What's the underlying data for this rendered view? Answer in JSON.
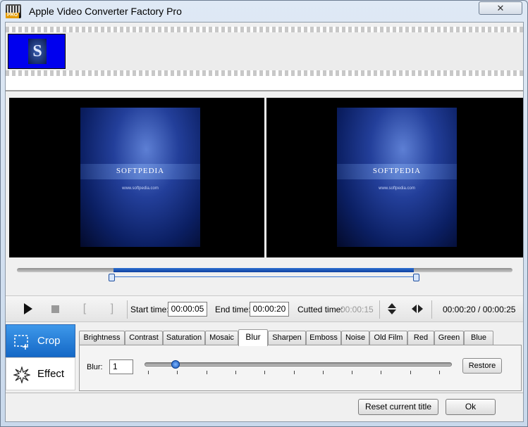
{
  "window": {
    "title": "Apple Video Converter Factory Pro",
    "close_glyph": "✕",
    "icon_badge": "PRO"
  },
  "thumbnail": {
    "glyph": "S"
  },
  "preview": {
    "brand": "SOFTPEDIA",
    "url": "www.softpedia.com"
  },
  "timeline": {
    "selection_start_fraction": 0.8,
    "selection_end_fraction": 1.0
  },
  "controls": {
    "bracket_left": "[",
    "bracket_right": "]",
    "start_time_label": "Start time:",
    "start_time_value": "00:00:05",
    "end_time_label": "End time:",
    "end_time_value": "00:00:20",
    "cutted_time_label": "Cutted time:",
    "cutted_time_value": "00:00:15",
    "position_display": "00:00:20 / 00:00:25"
  },
  "side_panel": {
    "crop_label": "Crop",
    "effect_label": "Effect"
  },
  "tabs": [
    {
      "label": "Brightness"
    },
    {
      "label": "Contrast"
    },
    {
      "label": "Saturation"
    },
    {
      "label": "Mosaic"
    },
    {
      "label": "Blur"
    },
    {
      "label": "Sharpen"
    },
    {
      "label": "Emboss"
    },
    {
      "label": "Noise"
    },
    {
      "label": "Old Film"
    },
    {
      "label": "Red"
    },
    {
      "label": "Green"
    },
    {
      "label": "Blue"
    }
  ],
  "active_tab": "Blur",
  "blur": {
    "label": "Blur:",
    "value": "1",
    "slider_fraction": 0.1,
    "restore_label": "Restore"
  },
  "footer": {
    "reset_label": "Reset current title",
    "ok_label": "Ok"
  },
  "colors": {
    "accent": "#1468c6",
    "selection": "#2c6fd0"
  }
}
